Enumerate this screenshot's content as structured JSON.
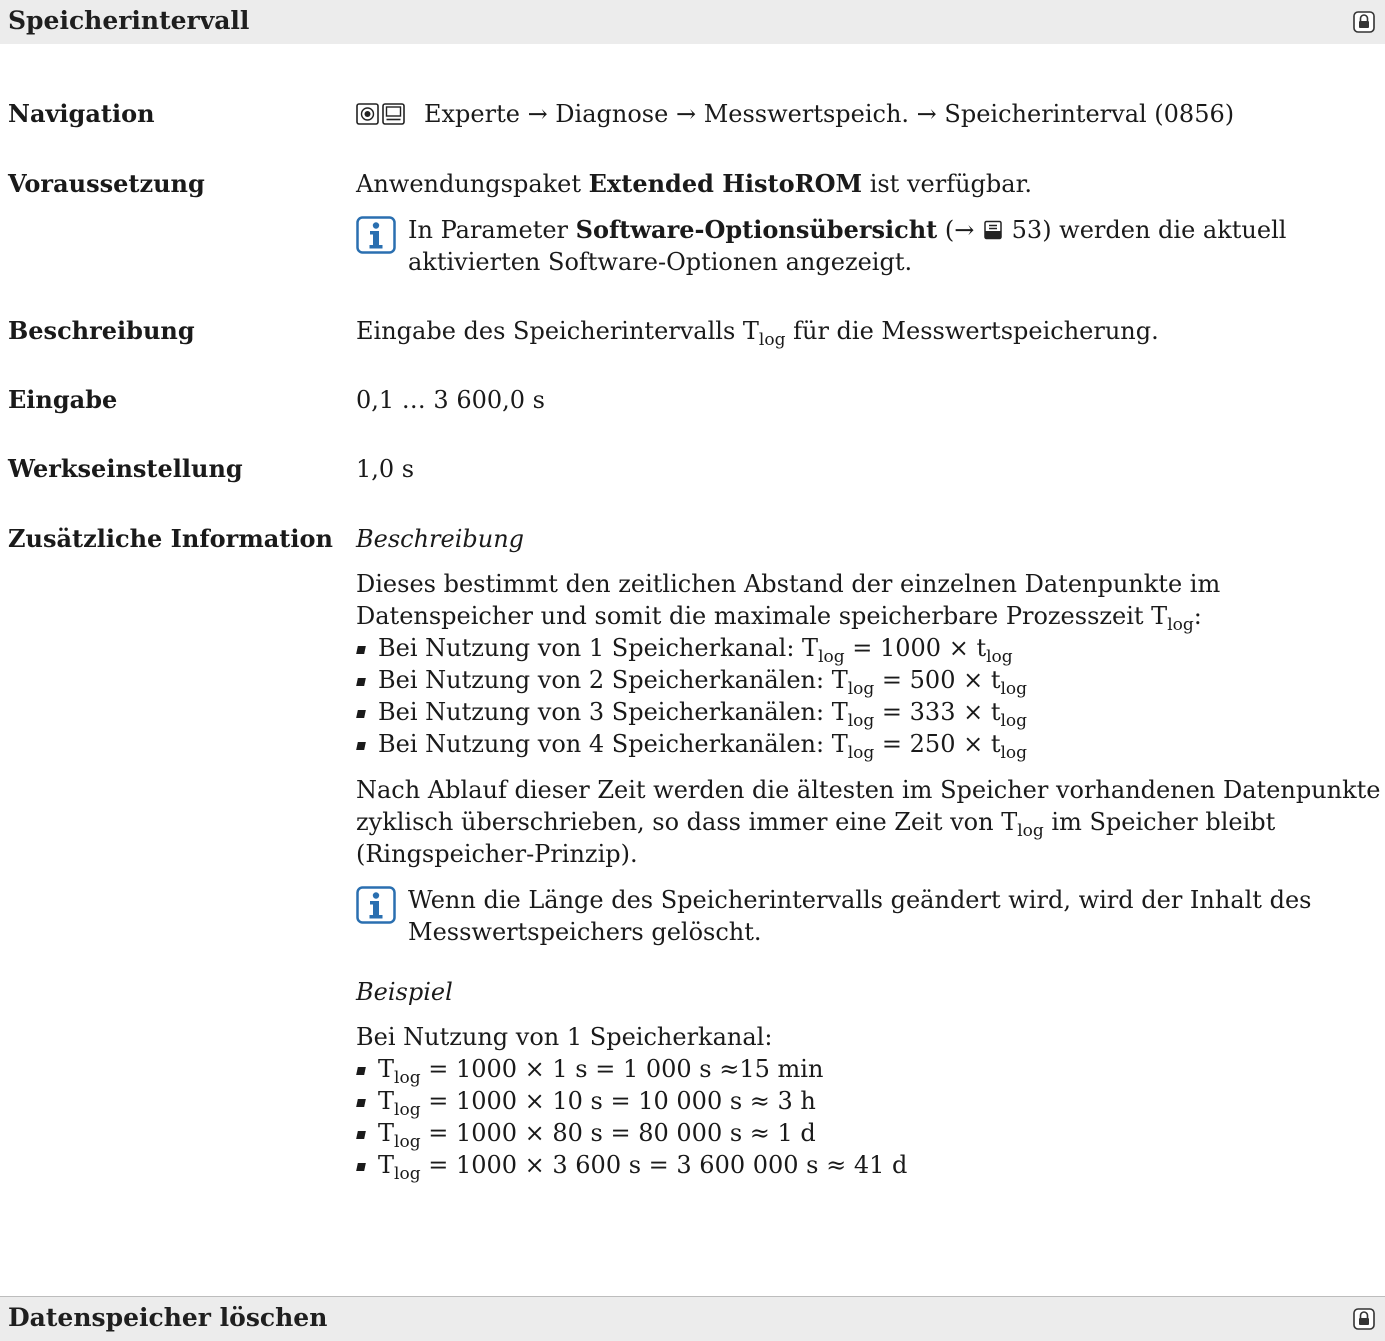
{
  "section1": {
    "title": "Speicherintervall"
  },
  "navigation": {
    "label": "Navigation",
    "path": "Experte → Diagnose → Messwertspeich. → Speicherinterval (0856)"
  },
  "voraussetzung": {
    "label": "Voraussetzung",
    "text_pre": "Anwendungspaket ",
    "text_bold": "Extended HistoROM",
    "text_post": " ist verfügbar.",
    "note_pre": "In Parameter ",
    "note_bold": "Software-Optionsübersicht",
    "note_ref_pre": " (→ ",
    "note_page": "53",
    "note_post": ") werden die aktuell aktivierten Software-Optionen angezeigt."
  },
  "beschreibung": {
    "label": "Beschreibung",
    "text_pre": "Eingabe des Speicherintervalls T",
    "sub": "log",
    "text_post": " für die Messwertspeicherung."
  },
  "eingabe": {
    "label": "Eingabe",
    "value": "0,1 … 3 600,0 s"
  },
  "werkseinstellung": {
    "label": "Werkseinstellung",
    "value": "1,0 s"
  },
  "zusatz": {
    "label": "Zusätzliche Information",
    "heading1": "Beschreibung",
    "para1_pre": "Dieses bestimmt den zeitlichen Abstand der einzelnen Datenpunkte im Datenspeicher und somit die maximale speicherbare Prozesszeit T",
    "para1_sub": "log",
    "para1_post": ":",
    "list1": [
      {
        "pre": "Bei Nutzung von 1 Speicherkanal: T",
        "mid": " = 1000 × t"
      },
      {
        "pre": "Bei Nutzung von 2 Speicherkanälen: T",
        "mid": " = 500 × t"
      },
      {
        "pre": "Bei Nutzung von 3 Speicherkanälen: T",
        "mid": " = 333 × t"
      },
      {
        "pre": "Bei Nutzung von 4 Speicherkanälen: T",
        "mid": " = 250 × t"
      }
    ],
    "sub": "log",
    "para2_pre": "Nach Ablauf dieser Zeit werden die ältesten im Speicher vorhandenen Datenpunkte zyklisch überschrieben, so dass immer eine Zeit von T",
    "para2_post": " im Speicher bleibt (Ringspeicher-Prinzip).",
    "note2": "Wenn die Länge des Speicherintervalls geändert wird, wird der Inhalt des Messwertspeichers gelöscht.",
    "heading2": "Beispiel",
    "example_intro": "Bei Nutzung von 1 Speicherkanal:",
    "list2": [
      {
        "pre": "T",
        "post": " = 1000 × 1 s = 1 000 s ≈15 min"
      },
      {
        "pre": "T",
        "post": " = 1000 × 10 s = 10 000 s ≈ 3 h"
      },
      {
        "pre": "T",
        "post": " = 1000 × 80 s = 80 000 s ≈ 1 d"
      },
      {
        "pre": "T",
        "post": " = 1000 × 3 600 s = 3 600 000 s ≈ 41 d"
      }
    ]
  },
  "section2": {
    "title": "Datenspeicher löschen"
  }
}
